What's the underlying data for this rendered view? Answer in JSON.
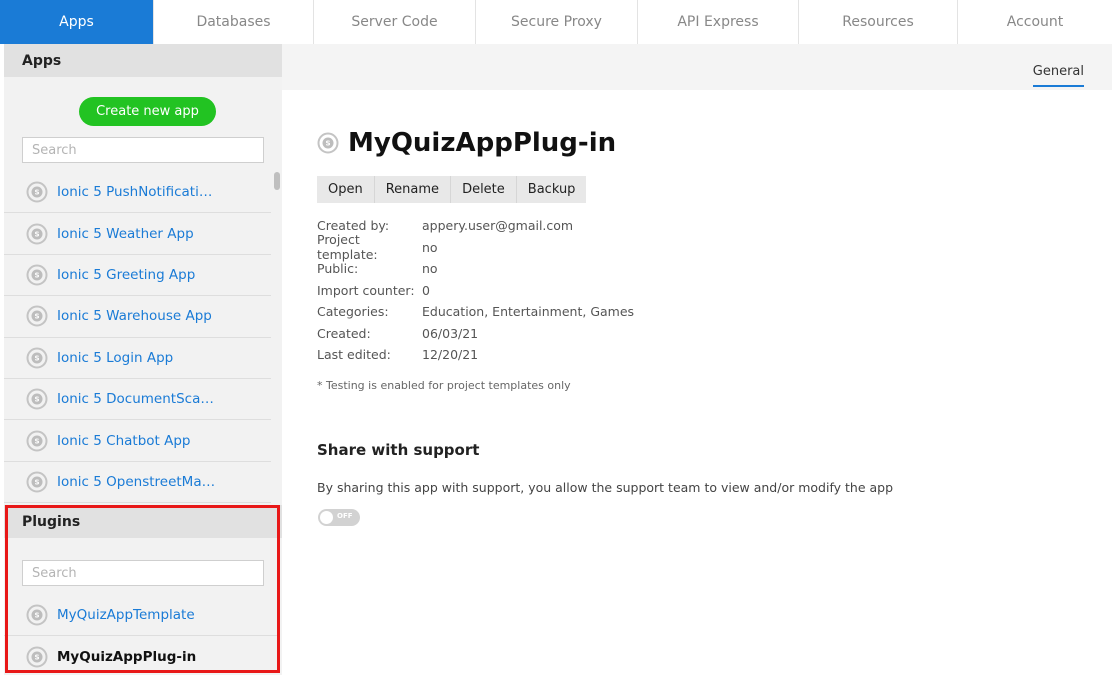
{
  "nav": {
    "tabs": [
      "Apps",
      "Databases",
      "Server Code",
      "Secure Proxy",
      "API Express",
      "Resources",
      "Account"
    ],
    "active": "Apps"
  },
  "sidebar": {
    "apps_header": "Apps",
    "create_button": "Create new app",
    "search_placeholder": "Search",
    "apps": [
      "Ionic 5 PushNotification...",
      "Ionic 5 Weather App",
      "Ionic 5 Greeting App",
      "Ionic 5 Warehouse App",
      "Ionic 5 Login App",
      "Ionic 5 DocumentScan...",
      "Ionic 5 Chatbot App",
      "Ionic 5 OpenstreetMap ..."
    ],
    "plugins_header": "Plugins",
    "plugins_search_placeholder": "Search",
    "plugins": [
      "MyQuizAppTemplate",
      "MyQuizAppPlug-in"
    ]
  },
  "main": {
    "general_tab": "General",
    "title": "MyQuizAppPlug-in",
    "actions": [
      "Open",
      "Rename",
      "Delete",
      "Backup"
    ],
    "meta": [
      {
        "label": "Created by:",
        "value": "appery.user@gmail.com"
      },
      {
        "label": "Project template:",
        "value": "no"
      },
      {
        "label": "Public:",
        "value": "no"
      },
      {
        "label": "Import counter:",
        "value": "0"
      },
      {
        "label": "Categories:",
        "value": "Education, Entertainment, Games"
      },
      {
        "label": "Created:",
        "value": "06/03/21"
      },
      {
        "label": "Last edited:",
        "value": "12/20/21"
      }
    ],
    "note": "* Testing is enabled for project templates only",
    "share_title": "Share with support",
    "share_desc": "By sharing this app with support, you allow the support team to view and/or modify the app",
    "toggle_label": "OFF"
  },
  "colors": {
    "accent": "#1a7bd6",
    "create_button": "#22c322",
    "highlight_box": "#e81818"
  },
  "icons": {
    "app_icon": "ionic-app-icon"
  }
}
